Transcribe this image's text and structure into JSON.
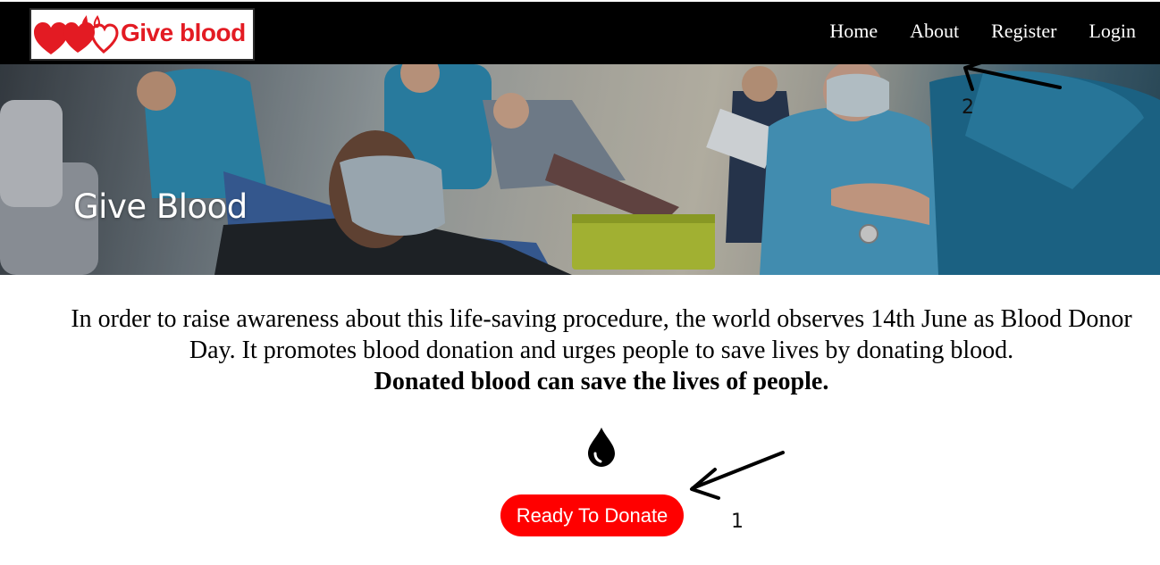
{
  "brand": {
    "name": "Give blood",
    "logo_color": "#e31b23"
  },
  "nav": {
    "items": [
      {
        "label": "Home"
      },
      {
        "label": "About"
      },
      {
        "label": "Register"
      },
      {
        "label": "Login"
      }
    ]
  },
  "hero": {
    "title": "Give Blood"
  },
  "intro": {
    "text": "In order to raise awareness about this life-saving procedure, the world observes 14th June as Blood Donor Day. It promotes blood donation and urges people to save lives by donating blood.",
    "emphasis": "Donated blood can save the lives of people."
  },
  "cta": {
    "icon": "blood-drop-icon",
    "label": "Ready To Donate",
    "color": "#ff0000"
  },
  "annotations": [
    {
      "number": "1",
      "target": "Ready To Donate"
    },
    {
      "number": "2",
      "target": "About"
    }
  ]
}
